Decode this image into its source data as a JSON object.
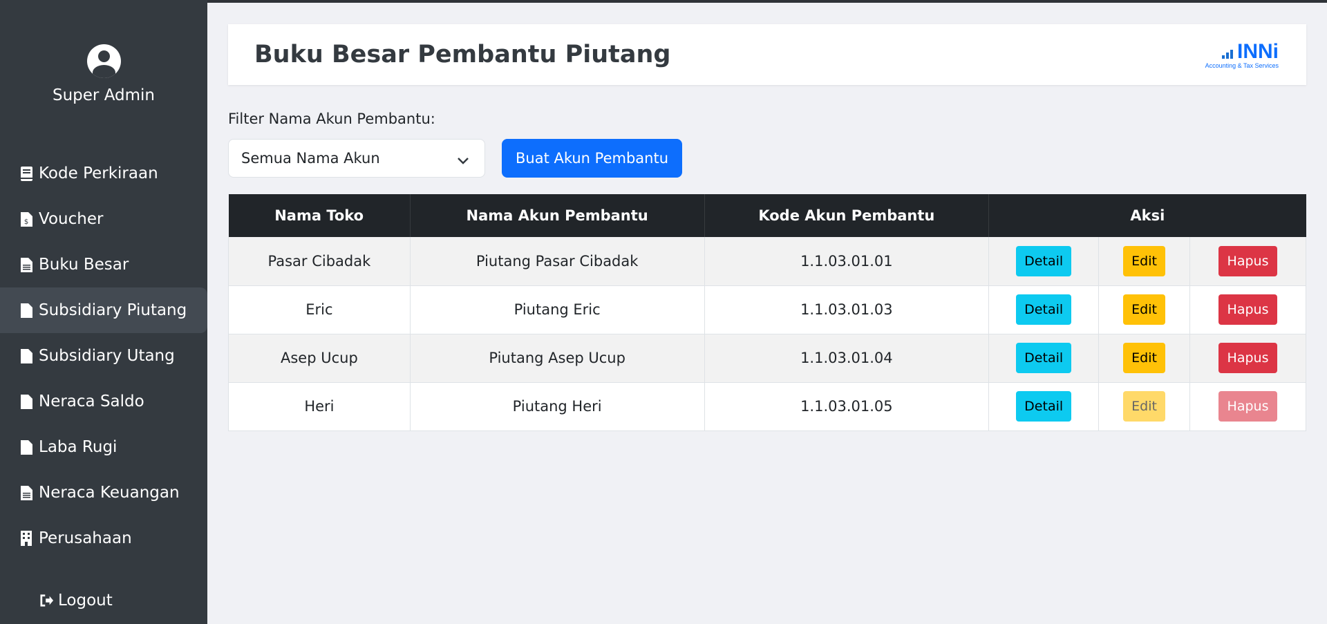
{
  "sidebar": {
    "user_name": "Super Admin",
    "items": [
      {
        "label": "Kode Perkiraan",
        "icon": "book-icon",
        "active": false
      },
      {
        "label": "Voucher",
        "icon": "invoice-icon",
        "active": false
      },
      {
        "label": "Buku Besar",
        "icon": "document-icon",
        "active": false
      },
      {
        "label": "Subsidiary Piutang",
        "icon": "document-icon",
        "active": true
      },
      {
        "label": "Subsidiary Utang",
        "icon": "document-icon",
        "active": false
      },
      {
        "label": "Neraca Saldo",
        "icon": "document-icon",
        "active": false
      },
      {
        "label": "Laba Rugi",
        "icon": "document-icon",
        "active": false
      },
      {
        "label": "Neraca Keuangan",
        "icon": "document-icon",
        "active": false
      },
      {
        "label": "Perusahaan",
        "icon": "building-icon",
        "active": false
      }
    ],
    "logout_label": "Logout"
  },
  "header": {
    "title": "Buku Besar Pembantu Piutang",
    "logo_text": "INNi",
    "logo_subtitle": "Accounting & Tax Services"
  },
  "filter": {
    "label": "Filter Nama Akun Pembantu:",
    "selected": "Semua Nama Akun",
    "create_button": "Buat Akun Pembantu"
  },
  "table": {
    "columns": [
      "Nama Toko",
      "Nama Akun Pembantu",
      "Kode Akun Pembantu",
      "Aksi"
    ],
    "action_labels": {
      "detail": "Detail",
      "edit": "Edit",
      "delete": "Hapus"
    },
    "rows": [
      {
        "toko": "Pasar Cibadak",
        "akun": "Piutang Pasar Cibadak",
        "kode": "1.1.03.01.01",
        "disabled": false
      },
      {
        "toko": "Eric",
        "akun": "Piutang Eric",
        "kode": "1.1.03.01.03",
        "disabled": false
      },
      {
        "toko": "Asep Ucup",
        "akun": "Piutang Asep Ucup",
        "kode": "1.1.03.01.04",
        "disabled": false
      },
      {
        "toko": "Heri",
        "akun": "Piutang Heri",
        "kode": "1.1.03.01.05",
        "disabled": true
      }
    ]
  },
  "colors": {
    "sidebar_bg": "#343a40",
    "primary": "#0d6efd",
    "info": "#0dcaf0",
    "warning": "#ffc107",
    "danger": "#dc3545",
    "table_header": "#212529"
  }
}
